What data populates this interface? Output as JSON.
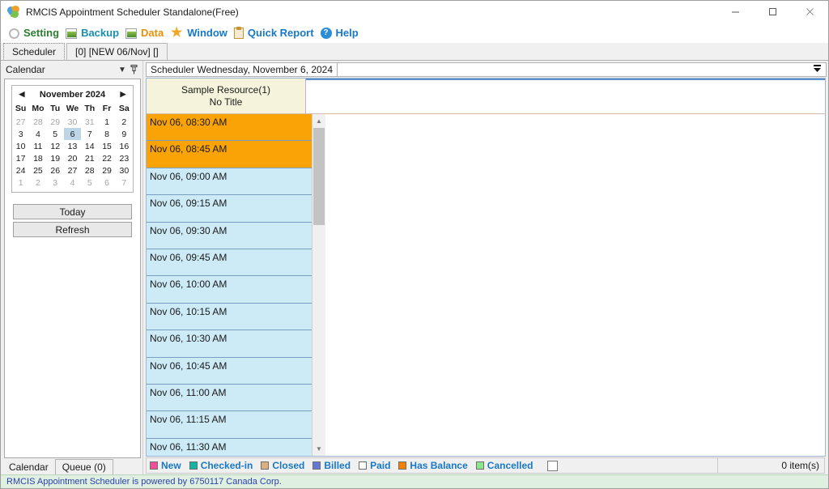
{
  "window": {
    "title": "RMCIS Appointment Scheduler Standalone(Free)",
    "icon": "app-puzzle-icon",
    "minimize": "–",
    "maximize": "☐",
    "close": "✕"
  },
  "menubar": [
    {
      "label": "Setting",
      "icon": "gear-icon",
      "color": "#2d7d32"
    },
    {
      "label": "Backup",
      "icon": "image-export-icon",
      "color": "#1a8fb0"
    },
    {
      "label": "Data",
      "icon": "image-data-icon",
      "color": "#e8900c"
    },
    {
      "label": "Window",
      "icon": "star-icon",
      "color": "#1878c8"
    },
    {
      "label": "Quick Report",
      "icon": "clipboard-icon",
      "color": "#1878c8"
    },
    {
      "label": "Help",
      "icon": "help-circle-icon",
      "color": "#1878c8"
    }
  ],
  "tabs": [
    {
      "label": "Scheduler",
      "active": true
    },
    {
      "label": "[0] [NEW 06/Nov] []",
      "active": false
    }
  ],
  "sidebar": {
    "header": {
      "title": "Calendar",
      "dropdown_icon": "chevron-down-icon",
      "pin_icon": "pin-icon"
    },
    "calendar": {
      "prev_icon": "arrow-left-icon",
      "next_icon": "arrow-right-icon",
      "month_title": "November 2024",
      "weekdays": [
        "Su",
        "Mo",
        "Tu",
        "We",
        "Th",
        "Fr",
        "Sa"
      ],
      "selected_day": 6,
      "weeks": [
        [
          {
            "d": "27",
            "o": 1
          },
          {
            "d": "28",
            "o": 1
          },
          {
            "d": "29",
            "o": 1
          },
          {
            "d": "30",
            "o": 1
          },
          {
            "d": "31",
            "o": 1
          },
          {
            "d": "1",
            "o": 0
          },
          {
            "d": "2",
            "o": 0
          }
        ],
        [
          {
            "d": "3",
            "o": 0
          },
          {
            "d": "4",
            "o": 0
          },
          {
            "d": "5",
            "o": 0
          },
          {
            "d": "6",
            "o": 0,
            "s": 1
          },
          {
            "d": "7",
            "o": 0
          },
          {
            "d": "8",
            "o": 0
          },
          {
            "d": "9",
            "o": 0
          }
        ],
        [
          {
            "d": "10",
            "o": 0
          },
          {
            "d": "11",
            "o": 0
          },
          {
            "d": "12",
            "o": 0
          },
          {
            "d": "13",
            "o": 0
          },
          {
            "d": "14",
            "o": 0
          },
          {
            "d": "15",
            "o": 0
          },
          {
            "d": "16",
            "o": 0
          }
        ],
        [
          {
            "d": "17",
            "o": 0
          },
          {
            "d": "18",
            "o": 0
          },
          {
            "d": "19",
            "o": 0
          },
          {
            "d": "20",
            "o": 0
          },
          {
            "d": "21",
            "o": 0
          },
          {
            "d": "22",
            "o": 0
          },
          {
            "d": "23",
            "o": 0
          }
        ],
        [
          {
            "d": "24",
            "o": 0
          },
          {
            "d": "25",
            "o": 0
          },
          {
            "d": "26",
            "o": 0
          },
          {
            "d": "27",
            "o": 0
          },
          {
            "d": "28",
            "o": 0
          },
          {
            "d": "29",
            "o": 0
          },
          {
            "d": "30",
            "o": 0
          }
        ],
        [
          {
            "d": "1",
            "o": 1
          },
          {
            "d": "2",
            "o": 1
          },
          {
            "d": "3",
            "o": 1
          },
          {
            "d": "4",
            "o": 1
          },
          {
            "d": "5",
            "o": 1
          },
          {
            "d": "6",
            "o": 1
          },
          {
            "d": "7",
            "o": 1
          }
        ]
      ]
    },
    "buttons": [
      {
        "label": "Today"
      },
      {
        "label": "Refresh"
      }
    ],
    "bottom_tabs": [
      {
        "label": "Calendar",
        "active": false
      },
      {
        "label": "Queue (0)",
        "active": true
      }
    ]
  },
  "scheduler": {
    "title": "Scheduler Wednesday, November 6, 2024",
    "expand_icon": "expand-collapse-icon",
    "resource_header": {
      "line1": "Sample Resource(1)",
      "line2": "No Title"
    },
    "scroll_up_icon": "scroll-up-icon",
    "scroll_down_icon": "scroll-down-icon",
    "slots": [
      {
        "label": "Nov 06, 08:30 AM",
        "state": "past"
      },
      {
        "label": "Nov 06, 08:45 AM",
        "state": "past"
      },
      {
        "label": "Nov 06, 09:00 AM",
        "state": "open"
      },
      {
        "label": "Nov 06, 09:15 AM",
        "state": "open"
      },
      {
        "label": "Nov 06, 09:30 AM",
        "state": "open"
      },
      {
        "label": "Nov 06, 09:45 AM",
        "state": "open"
      },
      {
        "label": "Nov 06, 10:00 AM",
        "state": "open"
      },
      {
        "label": "Nov 06, 10:15 AM",
        "state": "open"
      },
      {
        "label": "Nov 06, 10:30 AM",
        "state": "open"
      },
      {
        "label": "Nov 06, 10:45 AM",
        "state": "open"
      },
      {
        "label": "Nov 06, 11:00 AM",
        "state": "open"
      },
      {
        "label": "Nov 06, 11:15 AM",
        "state": "open"
      },
      {
        "label": "Nov 06, 11:30 AM",
        "state": "open"
      }
    ]
  },
  "legend": {
    "items": [
      {
        "label": "New",
        "color": "#f0509b"
      },
      {
        "label": "Checked-in",
        "color": "#12b5a5"
      },
      {
        "label": "Closed",
        "color": "#dcb180"
      },
      {
        "label": "Billed",
        "color": "#6478d8"
      },
      {
        "label": "Paid",
        "color": "#ffffff"
      },
      {
        "label": "Has Balance",
        "color": "#f77f00"
      },
      {
        "label": "Cancelled",
        "color": "#8ce68c"
      }
    ],
    "checkbox_label": "",
    "item_count": "0 item(s)"
  },
  "statusbar": {
    "text": "RMCIS Appointment Scheduler is powered by 6750117 Canada Corp."
  }
}
